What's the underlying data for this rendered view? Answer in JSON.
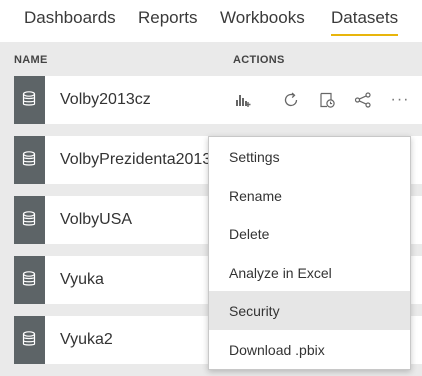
{
  "nav": {
    "tabs": [
      {
        "label": "Dashboards",
        "active": false
      },
      {
        "label": "Reports",
        "active": false
      },
      {
        "label": "Workbooks",
        "active": false
      },
      {
        "label": "Datasets",
        "active": true
      }
    ],
    "accent_color": "#e8b50c"
  },
  "table": {
    "columns": {
      "name": "NAME",
      "actions": "ACTIONS"
    },
    "rows": [
      {
        "name": "Volby2013cz",
        "icon": "database-icon",
        "show_actions": true
      },
      {
        "name": "VolbyPrezidenta2013",
        "icon": "database-icon",
        "show_actions": false
      },
      {
        "name": "VolbyUSA",
        "icon": "database-icon",
        "show_actions": false
      },
      {
        "name": "Vyuka",
        "icon": "database-icon",
        "show_actions": false
      },
      {
        "name": "Vyuka2",
        "icon": "database-icon",
        "show_actions": false
      }
    ],
    "action_icons": [
      "create-report-icon",
      "refresh-icon",
      "schedule-refresh-icon",
      "share-icon",
      "more-options-icon"
    ],
    "more_glyph": "···"
  },
  "context_menu": {
    "items": [
      {
        "label": "Settings",
        "highlighted": false
      },
      {
        "label": "Rename",
        "highlighted": false
      },
      {
        "label": "Delete",
        "highlighted": false
      },
      {
        "label": "Analyze in Excel",
        "highlighted": false
      },
      {
        "label": "Security",
        "highlighted": true
      },
      {
        "label": "Download .pbix",
        "highlighted": false
      }
    ],
    "highlight_color": "#e6e6e6"
  }
}
